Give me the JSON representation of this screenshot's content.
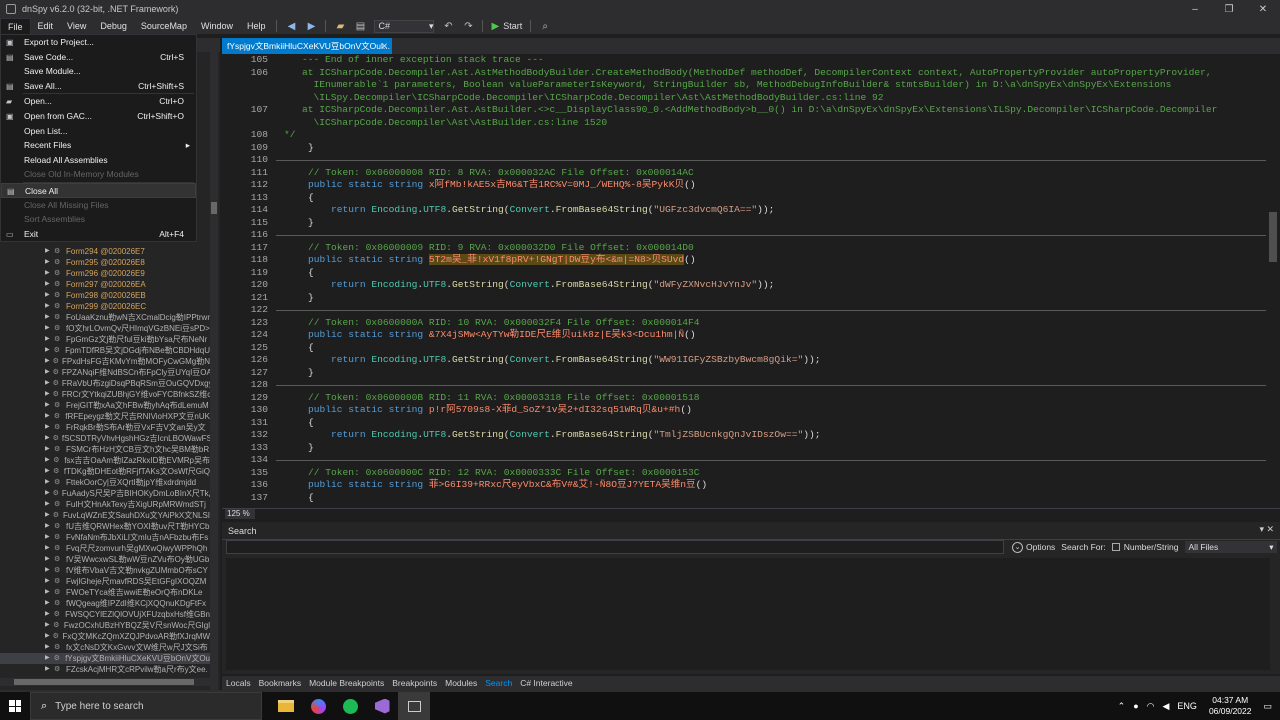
{
  "window": {
    "title": "dnSpy v6.2.0 (32-bit, .NET Framework)",
    "min": "–",
    "max": "❐",
    "close": "✕"
  },
  "menu": [
    "File",
    "Edit",
    "View",
    "Debug",
    "SourceMGM",
    "Window",
    "Help"
  ],
  "menu_real": [
    "File",
    "Edit",
    "View",
    "Debug",
    "SourceMap",
    "Window",
    "Help"
  ],
  "toolbar": {
    "language": "C#",
    "start": "Start"
  },
  "file_menu": {
    "items": [
      {
        "label": "Export to Project...",
        "shortcut": "",
        "enabled": true,
        "icon": "▣"
      },
      {
        "label": "Save Code...",
        "shortcut": "Ctrl+S",
        "enabled": true,
        "icon": "▤"
      },
      {
        "label": "Save Module...",
        "shortcut": "",
        "enabled": true,
        "icon": ""
      },
      {
        "label": "Save All...",
        "shortcut": "Ctrl+Shift+S",
        "enabled": true,
        "icon": "▤"
      },
      {
        "label": "Open...",
        "shortcut": "Ctrl+O",
        "enabled": true,
        "icon": "▰"
      },
      {
        "label": "Open from GAC...",
        "shortcut": "Ctrl+Shift+O",
        "enabled": true,
        "icon": "▣"
      },
      {
        "label": "Open List...",
        "shortcut": "",
        "enabled": true,
        "icon": ""
      },
      {
        "label": "Recent Files",
        "shortcut": "",
        "enabled": true,
        "icon": "",
        "submenu": true
      },
      {
        "label": "Reload All Assemblies",
        "shortcut": "",
        "enabled": true,
        "icon": ""
      },
      {
        "label": "Close Old In-Memory Modules",
        "shortcut": "",
        "enabled": false,
        "icon": ""
      },
      {
        "label": "Close All",
        "shortcut": "",
        "enabled": true,
        "icon": "▤",
        "hover": true
      },
      {
        "label": "Close All Missing Files",
        "shortcut": "",
        "enabled": false,
        "icon": ""
      },
      {
        "label": "Sort Assemblies",
        "shortcut": "",
        "enabled": false,
        "icon": ""
      },
      {
        "label": "Exit",
        "shortcut": "Alt+F4",
        "enabled": true,
        "icon": "▭"
      }
    ]
  },
  "tree": [
    {
      "t": "Form294 @020026E7",
      "form": true
    },
    {
      "t": "Form295 @020026E8",
      "form": true
    },
    {
      "t": "Form296 @020026E9",
      "form": true
    },
    {
      "t": "Form297 @020026EA",
      "form": true
    },
    {
      "t": "Form298 @020026EB",
      "form": true
    },
    {
      "t": "Form299 @020026EC",
      "form": true
    },
    {
      "t": "FoUaaKznu勒wN吉XCmalDcig勒IPPtrwr"
    },
    {
      "t": "fO文hrLOvmQv尺HImqVGzBNEi豆sPD>"
    },
    {
      "t": "FpGmGz文j勒尺ful豆ki勒bYsa尺布NeNr"
    },
    {
      "t": "FpmTDfRB吴文jDGdj布NBe勒CBDHdqU"
    },
    {
      "t": "FPxdHsFG吉KMvYm勒MOFyCwGMg勒N"
    },
    {
      "t": "FPZANqiF维NdBSCn布FpCly豆UYqI豆OA"
    },
    {
      "t": "FRaVbU布zgiDsqPBqRSm豆OuGQVDxgy"
    },
    {
      "t": "FRCr文YtkqiZUBhjGY维voFYCBfnkSZ维c"
    },
    {
      "t": "FrejGIT勒xAa文hFBw勒yhAq布dLemuM"
    },
    {
      "t": "fRFEpeygz勒文尺吉RNIVioHXP文豆nUK"
    },
    {
      "t": "FrRqkBr勒S布Ar勒豆VxF吉V文an吴y文"
    },
    {
      "t": "fSCSDTRyVhvHgshHGz吉IcnLBOWawFS"
    },
    {
      "t": "FSMCr布HzH文CB豆文h文hc吴BM勒bR"
    },
    {
      "t": "fsx吉吉OaAm勒IZazRkxID勒EVMRp吴布"
    },
    {
      "t": "fTDKg勒DHEot勒RFjfTAKs文OsWf尺GiQ"
    },
    {
      "t": "FttekOorCy|豆XQrtI勒jpY维xdrdmjdd"
    },
    {
      "t": "FuAadyS尺吴P吉BIHOKyDmLoBInX尺Tk尺"
    },
    {
      "t": "FuIH文HnAkTexy吉XigURpMRWmdSTj"
    },
    {
      "t": "FuvLqWZnE文SauhDXu文YAiPkX文NLSI"
    },
    {
      "t": "fU吉维QRWHex勒YOXI勒uv尺T勒HYCb"
    },
    {
      "t": "FvNfaNm布JbXiLI文mIu吉nAFbzbu布Fs"
    },
    {
      "t": "Fvq尺尺zomvurh吴gMXwQiwyWPPhQh"
    },
    {
      "t": "fV吴WwcxwSL勒wW豆nZVu布Oy勒UGb"
    },
    {
      "t": "fV维布VbaV吉文勒nvkgZUMmbO布sCY"
    },
    {
      "t": "FwjlGheje尺mavfRDS吴EtGFgIXOQZM"
    },
    {
      "t": "FWOeTYca维吉wwiE勒eOrQ布nDKLe"
    },
    {
      "t": "fWQgeag维IPZdI维KCjXQQnuKDgFtFx"
    },
    {
      "t": "FWSQCYlEZlQlOVUjXFUzqbxHsf维GBn"
    },
    {
      "t": "FwzOCxhUBzHYBQZ吴V尺snWoc尺GIgl"
    },
    {
      "t": "FxQ文MKcZQmXZQJPdvoAR勒fXJrqMW"
    },
    {
      "t": "fx文cNsD文KxGvvv文W维尺w尺J文Si布"
    },
    {
      "t": "fYspjgv文BmkiiHluCXeKVU豆bOnV文Ou",
      "sel": true
    },
    {
      "t": "FZcskAcjMHR文cRPvilw勒a尺r布y文ee."
    }
  ],
  "editor": {
    "tab": "fYspjgv文BmkiiHluCXeKVU豆bOnV文Oul...",
    "zoom": "125 %",
    "lines": [
      {
        "n": "105",
        "segs": [
          [
            "c-cm",
            "--- End of inner exception stack trace ---"
          ]
        ]
      },
      {
        "n": "106",
        "segs": [
          [
            "c-cm",
            "at ICSharpCode.Decompiler.Ast.AstMethodBodyBuilder.CreateMethodBody(MethodDef methodDef, DecompilerContext context, AutoPropertyProvider autoPropertyProvider,"
          ]
        ]
      },
      {
        "n": "",
        "segs": [
          [
            "c-cm",
            "  IEnumerable`1 parameters, Boolean valueParameterIsKeyword, StringBuilder sb, MethodDebugInfoBuilder& stmtsBuilder) in D:\\a\\dnSpyEx\\dnSpyEx\\Extensions"
          ]
        ]
      },
      {
        "n": "",
        "segs": [
          [
            "c-cm",
            "  \\ILSpy.Decompiler\\ICSharpCode.Decompiler\\ICSharpCode.Decompiler\\Ast\\AstMethodBodyBuilder.cs:line 92"
          ]
        ]
      },
      {
        "n": "107",
        "segs": [
          [
            "c-cm",
            "at ICSharpCode.Decompiler.Ast.AstBuilder.<>c__DisplayClass90_0.<AddMethodBody>b__0() in D:\\a\\dnSpyEx\\dnSpyEx\\Extensions\\ILSpy.Decompiler\\ICSharpCode.Decompiler"
          ]
        ]
      },
      {
        "n": "",
        "segs": [
          [
            "c-cm",
            "  \\ICSharpCode.Decompiler\\Ast\\AstBuilder.cs:line 1520"
          ]
        ]
      },
      {
        "n": "108",
        "segs": [
          [
            "c-cm",
            "*/"
          ]
        ],
        "indent": -3
      },
      {
        "n": "109",
        "segs": [
          [
            "c-pl",
            "}"
          ]
        ]
      },
      {
        "n": "110",
        "segs": [],
        "div": true
      },
      {
        "n": "111",
        "segs": [
          [
            "c-cm",
            "// Token: 0x06000008 RID: 8 RVA: 0x000032AC File Offset: 0x000014AC"
          ]
        ]
      },
      {
        "n": "112",
        "segs": [
          [
            "c-kw",
            "public static string "
          ],
          [
            "c-id",
            "x阿fMb!kAE5x吉M6&T吉1RC%V=0MJ_/WEHQ%-8吴PykK贝"
          ],
          [
            "c-pl",
            "()"
          ]
        ]
      },
      {
        "n": "113",
        "segs": [
          [
            "c-pl",
            "{"
          ]
        ]
      },
      {
        "n": "114",
        "segs": [
          [
            "c-pl",
            "    "
          ],
          [
            "c-kw",
            "return "
          ],
          [
            "c-ty",
            "Encoding"
          ],
          [
            "c-pl",
            "."
          ],
          [
            "c-ty",
            "UTF8"
          ],
          [
            "c-pl",
            "."
          ],
          [
            "c-nm",
            "GetString"
          ],
          [
            "c-pl",
            "("
          ],
          [
            "c-ty",
            "Convert"
          ],
          [
            "c-pl",
            "."
          ],
          [
            "c-nm",
            "FromBase64String"
          ],
          [
            "c-pl",
            "("
          ],
          [
            "c-st",
            "\"UGFzc3dvcmQ6IA==\""
          ],
          [
            "c-pl",
            "));"
          ]
        ]
      },
      {
        "n": "115",
        "segs": [
          [
            "c-pl",
            "}"
          ]
        ]
      },
      {
        "n": "116",
        "segs": [],
        "div": true
      },
      {
        "n": "117",
        "segs": [
          [
            "c-cm",
            "// Token: 0x06000009 RID: 9 RVA: 0x000032D0 File Offset: 0x000014D0"
          ]
        ]
      },
      {
        "n": "118",
        "segs": [
          [
            "c-kw",
            "public static string "
          ],
          [
            "hl",
            "5T2m吴_菲!xV1f8pRV+!GNgT|DW豆y布<&m|=N8>贝SUvd"
          ],
          [
            "c-pl",
            "()"
          ]
        ]
      },
      {
        "n": "119",
        "segs": [
          [
            "c-pl",
            "{"
          ]
        ]
      },
      {
        "n": "120",
        "segs": [
          [
            "c-pl",
            "    "
          ],
          [
            "c-kw",
            "return "
          ],
          [
            "c-ty",
            "Encoding"
          ],
          [
            "c-pl",
            "."
          ],
          [
            "c-ty",
            "UTF8"
          ],
          [
            "c-pl",
            "."
          ],
          [
            "c-nm",
            "GetString"
          ],
          [
            "c-pl",
            "("
          ],
          [
            "c-ty",
            "Convert"
          ],
          [
            "c-pl",
            "."
          ],
          [
            "c-nm",
            "FromBase64String"
          ],
          [
            "c-pl",
            "("
          ],
          [
            "c-st",
            "\"dWFyZXNvcHJvYnJv\""
          ],
          [
            "c-pl",
            "));"
          ]
        ]
      },
      {
        "n": "121",
        "segs": [
          [
            "c-pl",
            "}"
          ]
        ]
      },
      {
        "n": "122",
        "segs": [],
        "div": true
      },
      {
        "n": "123",
        "segs": [
          [
            "c-cm",
            "// Token: 0x0600000A RID: 10 RVA: 0x000032F4 File Offset: 0x000014F4"
          ]
        ]
      },
      {
        "n": "124",
        "segs": [
          [
            "c-kw",
            "public static string "
          ],
          [
            "c-id",
            "&7X4jSMw<AyTYw勒IDE尺E维贝uik8z|E吴k3<Dcu1hm|Ñ"
          ],
          [
            "c-pl",
            "()"
          ]
        ]
      },
      {
        "n": "125",
        "segs": [
          [
            "c-pl",
            "{"
          ]
        ]
      },
      {
        "n": "126",
        "segs": [
          [
            "c-pl",
            "    "
          ],
          [
            "c-kw",
            "return "
          ],
          [
            "c-ty",
            "Encoding"
          ],
          [
            "c-pl",
            "."
          ],
          [
            "c-ty",
            "UTF8"
          ],
          [
            "c-pl",
            "."
          ],
          [
            "c-nm",
            "GetString"
          ],
          [
            "c-pl",
            "("
          ],
          [
            "c-ty",
            "Convert"
          ],
          [
            "c-pl",
            "."
          ],
          [
            "c-nm",
            "FromBase64String"
          ],
          [
            "c-pl",
            "("
          ],
          [
            "c-st",
            "\"WW91IGFyZSBzbyBwcm8gQik=\""
          ],
          [
            "c-pl",
            "));"
          ]
        ]
      },
      {
        "n": "127",
        "segs": [
          [
            "c-pl",
            "}"
          ]
        ]
      },
      {
        "n": "128",
        "segs": [],
        "div": true
      },
      {
        "n": "129",
        "segs": [
          [
            "c-cm",
            "// Token: 0x0600000B RID: 11 RVA: 0x00003318 File Offset: 0x00001518"
          ]
        ]
      },
      {
        "n": "130",
        "segs": [
          [
            "c-kw",
            "public static string "
          ],
          [
            "c-id",
            "p!r阿5709s8-X菲d_SoZ*1v吴2+dI32sq51WRq贝&u+#h"
          ],
          [
            "c-pl",
            "()"
          ]
        ]
      },
      {
        "n": "131",
        "segs": [
          [
            "c-pl",
            "{"
          ]
        ]
      },
      {
        "n": "132",
        "segs": [
          [
            "c-pl",
            "    "
          ],
          [
            "c-kw",
            "return "
          ],
          [
            "c-ty",
            "Encoding"
          ],
          [
            "c-pl",
            "."
          ],
          [
            "c-ty",
            "UTF8"
          ],
          [
            "c-pl",
            "."
          ],
          [
            "c-nm",
            "GetString"
          ],
          [
            "c-pl",
            "("
          ],
          [
            "c-ty",
            "Convert"
          ],
          [
            "c-pl",
            "."
          ],
          [
            "c-nm",
            "FromBase64String"
          ],
          [
            "c-pl",
            "("
          ],
          [
            "c-st",
            "\"TmljZSBUcnkgQnJvIDszOw==\""
          ],
          [
            "c-pl",
            "));"
          ]
        ]
      },
      {
        "n": "133",
        "segs": [
          [
            "c-pl",
            "}"
          ]
        ]
      },
      {
        "n": "134",
        "segs": [],
        "div": true
      },
      {
        "n": "135",
        "segs": [
          [
            "c-cm",
            "// Token: 0x0600000C RID: 12 RVA: 0x0000333C File Offset: 0x0000153C"
          ]
        ]
      },
      {
        "n": "136",
        "segs": [
          [
            "c-kw",
            "public static string "
          ],
          [
            "c-id",
            "菲>G6I39+RRxc尺eyVbxC&布V#&艾!-Ñ8O豆J?YETA吴维n豆"
          ],
          [
            "c-pl",
            "()"
          ]
        ]
      },
      {
        "n": "137",
        "segs": [
          [
            "c-pl",
            "{"
          ]
        ]
      }
    ]
  },
  "search": {
    "title": "Search",
    "options": "Options",
    "search_for": "Search For:",
    "type": "Number/String",
    "files": "All Files"
  },
  "bottom_tabs": [
    "Locals",
    "Bookmarks",
    "Module Breakpoints",
    "Breakpoints",
    "Modules",
    "Search",
    "C# Interactive"
  ],
  "active_bottom_tab": "Search",
  "taskbar": {
    "search_placeholder": "Type here to search",
    "lang": "ENG",
    "time": "04:37 AM",
    "date": "06/09/2022"
  }
}
